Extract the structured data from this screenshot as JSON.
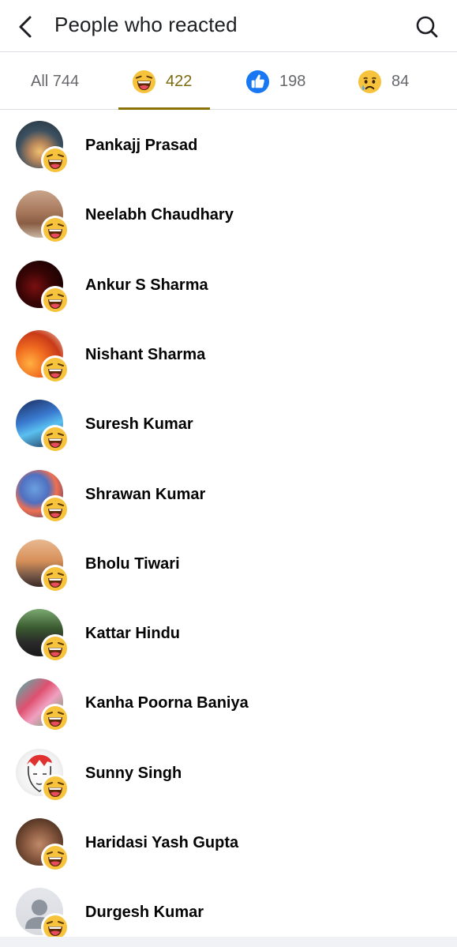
{
  "header": {
    "back_icon": "chevron-left-icon",
    "title": "People who reacted",
    "search_icon": "search-icon"
  },
  "tabs": [
    {
      "label": "All 744",
      "icon": null,
      "active": false
    },
    {
      "label": "422",
      "icon": "haha-emoji-icon",
      "active": true
    },
    {
      "label": "198",
      "icon": "like-thumb-icon",
      "active": false
    },
    {
      "label": "84",
      "icon": "sad-emoji-icon",
      "active": false
    }
  ],
  "people": [
    {
      "name": "Pankajj Prasad",
      "reaction": "haha-emoji-icon"
    },
    {
      "name": "Neelabh Chaudhary",
      "reaction": "haha-emoji-icon"
    },
    {
      "name": "Ankur S Sharma",
      "reaction": "haha-emoji-icon"
    },
    {
      "name": "Nishant Sharma",
      "reaction": "haha-emoji-icon"
    },
    {
      "name": "Suresh Kumar",
      "reaction": "haha-emoji-icon"
    },
    {
      "name": "Shrawan Kumar",
      "reaction": "haha-emoji-icon"
    },
    {
      "name": "Bholu Tiwari",
      "reaction": "haha-emoji-icon"
    },
    {
      "name": "Kattar Hindu",
      "reaction": "haha-emoji-icon"
    },
    {
      "name": "Kanha Poorna Baniya",
      "reaction": "haha-emoji-icon"
    },
    {
      "name": "Sunny Singh",
      "reaction": "haha-emoji-icon"
    },
    {
      "name": "Haridasi Yash Gupta",
      "reaction": "haha-emoji-icon"
    },
    {
      "name": "Durgesh Kumar",
      "reaction": "haha-emoji-icon"
    }
  ],
  "colors": {
    "accent": "#8a7208",
    "divider": "#dadde1",
    "like_blue": "#1877f2",
    "emoji_yellow": "#f7c33c"
  }
}
